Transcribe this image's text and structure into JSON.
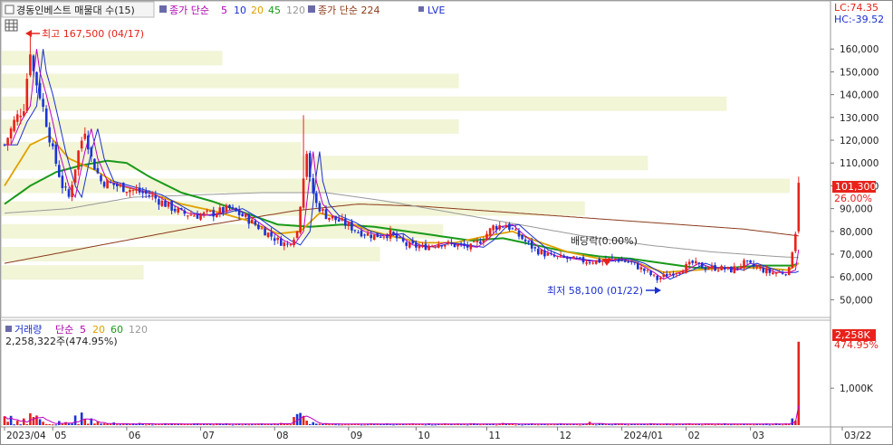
{
  "legend_main": {
    "title": "경동인베스트 매물대 수(15)",
    "ma_label": "종가 단순",
    "ma_periods": [
      "5",
      "10",
      "20",
      "45",
      "120"
    ],
    "ma_long_label": "종가 단순 224",
    "lve_label": "LVE"
  },
  "right_info": {
    "lc": "LC:74.35",
    "hc": "HC:-39.52"
  },
  "annotations": {
    "high": "최고 167,500 (04/17)",
    "low": "최저 58,100 (01/22)",
    "dividend": "배당락(0.00%)"
  },
  "price_badge": {
    "value": "101,300",
    "pct": "26.00%"
  },
  "volume_legend": {
    "title": "거래량",
    "ma_label": "단순",
    "ma_periods": [
      "5",
      "20",
      "60",
      "120"
    ],
    "current": "2,258,322주(474.95%)"
  },
  "volume_badge": {
    "value": "2,258K",
    "pct": "474.95%"
  },
  "colors": {
    "up": "#e8221b",
    "down": "#1b34d6",
    "ma5": "#c000c0",
    "ma10": "#1a2fd0",
    "ma20": "#e0a000",
    "ma45": "#1a9a1a",
    "ma120": "#999999",
    "ma224": "#8b3a1a",
    "profile": "#f2f5d6"
  },
  "chart_data": [
    {
      "type": "candlestick",
      "price_axis": {
        "ticks": [
          "160,000",
          "150,000",
          "140,000",
          "130,000",
          "120,000",
          "110,000",
          "100,000",
          "90,000",
          "80,000",
          "70,000",
          "60,000",
          "50,000"
        ],
        "tick_values": [
          160000,
          150000,
          140000,
          130000,
          120000,
          110000,
          100000,
          90000,
          80000,
          70000,
          60000,
          50000
        ],
        "ylim": [
          45000,
          172000
        ]
      },
      "x_axis": {
        "labels": [
          "2023/04",
          "05",
          "06",
          "07",
          "08",
          "09",
          "10",
          "11",
          "12",
          "2024/01",
          "02",
          "03",
          "03/22"
        ],
        "label_day_index": [
          0,
          15,
          38,
          61,
          84,
          107,
          128,
          150,
          172,
          192,
          212,
          232,
          254
        ]
      },
      "key_points": {
        "high": {
          "value": 167500,
          "date": "04/17"
        },
        "low": {
          "value": 58100,
          "date": "01/22"
        },
        "last_close": 101300,
        "last_change_pct": 26.0
      },
      "price_path": [
        [
          0,
          118000
        ],
        [
          3,
          128000
        ],
        [
          6,
          135000
        ],
        [
          8,
          160000
        ],
        [
          9,
          150000
        ],
        [
          11,
          140000
        ],
        [
          13,
          128000
        ],
        [
          15,
          115000
        ],
        [
          18,
          100000
        ],
        [
          20,
          95000
        ],
        [
          23,
          115000
        ],
        [
          25,
          125000
        ],
        [
          27,
          112000
        ],
        [
          30,
          102000
        ],
        [
          35,
          100000
        ],
        [
          40,
          98000
        ],
        [
          45,
          96000
        ],
        [
          50,
          92000
        ],
        [
          55,
          88000
        ],
        [
          60,
          87000
        ],
        [
          65,
          88000
        ],
        [
          70,
          90000
        ],
        [
          75,
          86000
        ],
        [
          80,
          81000
        ],
        [
          85,
          76000
        ],
        [
          88,
          74000
        ],
        [
          91,
          80000
        ],
        [
          93,
          105000
        ],
        [
          94,
          115000
        ],
        [
          95,
          102000
        ],
        [
          97,
          92000
        ],
        [
          100,
          87000
        ],
        [
          105,
          84000
        ],
        [
          110,
          80000
        ],
        [
          115,
          78000
        ],
        [
          120,
          79000
        ],
        [
          125,
          74000
        ],
        [
          130,
          73000
        ],
        [
          135,
          75000
        ],
        [
          140,
          74000
        ],
        [
          145,
          73000
        ],
        [
          148,
          76000
        ],
        [
          152,
          82000
        ],
        [
          156,
          83000
        ],
        [
          160,
          78000
        ],
        [
          165,
          72000
        ],
        [
          170,
          69000
        ],
        [
          175,
          68000
        ],
        [
          180,
          67000
        ],
        [
          185,
          67000
        ],
        [
          190,
          68000
        ],
        [
          195,
          66000
        ],
        [
          200,
          62000
        ],
        [
          203,
          59000
        ],
        [
          206,
          61000
        ],
        [
          210,
          63000
        ],
        [
          214,
          66000
        ],
        [
          218,
          64000
        ],
        [
          222,
          64000
        ],
        [
          226,
          63000
        ],
        [
          230,
          66000
        ],
        [
          234,
          64000
        ],
        [
          238,
          62000
        ],
        [
          242,
          62000
        ],
        [
          244,
          63000
        ],
        [
          245,
          72000
        ],
        [
          246,
          80000
        ],
        [
          247,
          101300
        ]
      ],
      "ma_paths": {
        "ma120": [
          [
            0,
            88000
          ],
          [
            20,
            90000
          ],
          [
            40,
            95000
          ],
          [
            60,
            96000
          ],
          [
            80,
            97000
          ],
          [
            100,
            97000
          ],
          [
            120,
            93000
          ],
          [
            140,
            88000
          ],
          [
            160,
            83000
          ],
          [
            180,
            78000
          ],
          [
            200,
            74000
          ],
          [
            220,
            71000
          ],
          [
            240,
            69000
          ],
          [
            247,
            68500
          ]
        ],
        "ma224": [
          [
            0,
            66000
          ],
          [
            30,
            74000
          ],
          [
            60,
            82000
          ],
          [
            90,
            89000
          ],
          [
            110,
            92000
          ],
          [
            130,
            91000
          ],
          [
            150,
            89000
          ],
          [
            170,
            87000
          ],
          [
            190,
            85000
          ],
          [
            210,
            83000
          ],
          [
            230,
            81000
          ],
          [
            247,
            78000
          ]
        ],
        "ma45": [
          [
            0,
            92000
          ],
          [
            8,
            100000
          ],
          [
            16,
            106000
          ],
          [
            24,
            109000
          ],
          [
            32,
            111000
          ],
          [
            38,
            110000
          ],
          [
            45,
            104000
          ],
          [
            55,
            97000
          ],
          [
            65,
            93000
          ],
          [
            75,
            88000
          ],
          [
            85,
            83000
          ],
          [
            95,
            82000
          ],
          [
            105,
            83000
          ],
          [
            115,
            82000
          ],
          [
            125,
            80000
          ],
          [
            135,
            78000
          ],
          [
            145,
            76000
          ],
          [
            155,
            77000
          ],
          [
            165,
            74000
          ],
          [
            175,
            71000
          ],
          [
            185,
            69000
          ],
          [
            195,
            68000
          ],
          [
            205,
            66000
          ],
          [
            215,
            64000
          ],
          [
            225,
            64000
          ],
          [
            235,
            65000
          ],
          [
            245,
            65000
          ],
          [
            247,
            66000
          ]
        ],
        "ma20": [
          [
            0,
            100000
          ],
          [
            8,
            118000
          ],
          [
            14,
            122000
          ],
          [
            20,
            112000
          ],
          [
            28,
            107000
          ],
          [
            36,
            100000
          ],
          [
            45,
            97000
          ],
          [
            55,
            92000
          ],
          [
            65,
            89000
          ],
          [
            75,
            85000
          ],
          [
            85,
            79000
          ],
          [
            92,
            80000
          ],
          [
            98,
            88000
          ],
          [
            104,
            86000
          ],
          [
            112,
            81000
          ],
          [
            120,
            78000
          ],
          [
            130,
            75000
          ],
          [
            140,
            75000
          ],
          [
            150,
            78000
          ],
          [
            158,
            80000
          ],
          [
            165,
            76000
          ],
          [
            175,
            71000
          ],
          [
            185,
            68000
          ],
          [
            195,
            67000
          ],
          [
            205,
            62000
          ],
          [
            215,
            63000
          ],
          [
            225,
            64000
          ],
          [
            235,
            64000
          ],
          [
            244,
            63000
          ],
          [
            247,
            66000
          ]
        ]
      },
      "volume_profile": [
        {
          "price": 156000,
          "volume": 0.28
        },
        {
          "price": 146000,
          "volume": 0.58
        },
        {
          "price": 136000,
          "volume": 0.92
        },
        {
          "price": 126000,
          "volume": 0.58
        },
        {
          "price": 116000,
          "volume": 0.38
        },
        {
          "price": 110000,
          "volume": 0.82
        },
        {
          "price": 100000,
          "volume": 1.0
        },
        {
          "price": 90000,
          "volume": 0.74
        },
        {
          "price": 80000,
          "volume": 0.56
        },
        {
          "price": 70000,
          "volume": 0.48
        },
        {
          "price": 62000,
          "volume": 0.18
        }
      ]
    },
    {
      "type": "bar",
      "name": "volume",
      "y_axis": {
        "ticks": [
          "1,000K"
        ],
        "tick_values": [
          1000000
        ],
        "ylim": [
          0,
          2400000
        ]
      },
      "current_volume": 2258322,
      "current_pct": 474.95,
      "spikes": [
        [
          0,
          240000
        ],
        [
          1,
          90000
        ],
        [
          2,
          250000
        ],
        [
          4,
          120000
        ],
        [
          6,
          180000
        ],
        [
          8,
          320000
        ],
        [
          9,
          220000
        ],
        [
          10,
          260000
        ],
        [
          11,
          160000
        ],
        [
          12,
          90000
        ],
        [
          17,
          110000
        ],
        [
          19,
          80000
        ],
        [
          22,
          260000
        ],
        [
          24,
          340000
        ],
        [
          25,
          160000
        ],
        [
          27,
          180000
        ],
        [
          29,
          90000
        ],
        [
          34,
          70000
        ],
        [
          42,
          60000
        ],
        [
          50,
          50000
        ],
        [
          60,
          50000
        ],
        [
          70,
          40000
        ],
        [
          80,
          45000
        ],
        [
          86,
          60000
        ],
        [
          90,
          220000
        ],
        [
          91,
          300000
        ],
        [
          92,
          330000
        ],
        [
          93,
          250000
        ],
        [
          94,
          120000
        ],
        [
          96,
          80000
        ],
        [
          100,
          50000
        ],
        [
          110,
          40000
        ],
        [
          120,
          35000
        ],
        [
          130,
          30000
        ],
        [
          140,
          35000
        ],
        [
          150,
          40000
        ],
        [
          155,
          60000
        ],
        [
          165,
          30000
        ],
        [
          175,
          25000
        ],
        [
          182,
          90000
        ],
        [
          186,
          35000
        ],
        [
          195,
          30000
        ],
        [
          205,
          25000
        ],
        [
          215,
          30000
        ],
        [
          225,
          28000
        ],
        [
          235,
          25000
        ],
        [
          245,
          180000
        ],
        [
          246,
          120000
        ],
        [
          247,
          2258322
        ]
      ]
    }
  ]
}
